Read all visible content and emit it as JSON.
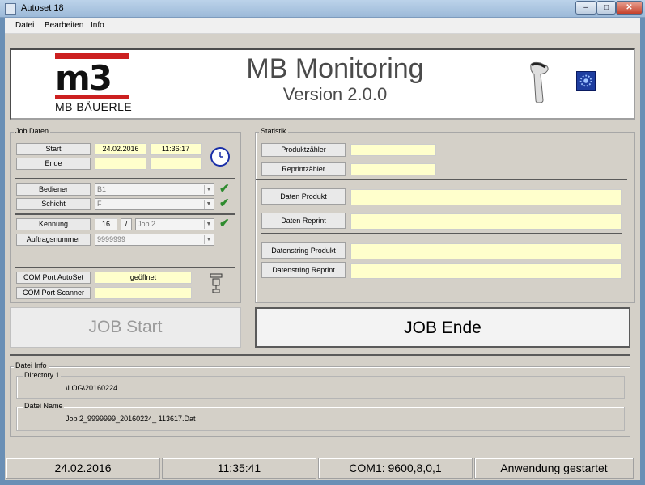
{
  "window": {
    "title": "Autoset 18",
    "minimize": "–",
    "maximize": "□",
    "close": "✕"
  },
  "menu": [
    "Datei",
    "Bearbeiten",
    "Info"
  ],
  "banner": {
    "logo_text": "MB BÄUERLE",
    "logo_mark": "m3",
    "title": "MB Monitoring",
    "version": "Version 2.0.0"
  },
  "job": {
    "group_title": "Job Daten",
    "start_label": "Start",
    "start_date": "24.02.2016",
    "start_time": "11:36:17",
    "end_label": "Ende",
    "end_date": "",
    "end_time": "",
    "operator_label": "Bediener",
    "operator_value": "B1",
    "shift_label": "Schicht",
    "shift_value": "F",
    "id_label": "Kennung",
    "id_num": "16",
    "id_sep": "/",
    "id_job": "Job 2",
    "order_label": "Auftragsnummer",
    "order_value": "9999999",
    "com_autoset_label": "COM Port AutoSet",
    "com_autoset_value": "geöffnet",
    "com_scanner_label": "COM Port Scanner",
    "com_scanner_value": ""
  },
  "stats": {
    "group_title": "Statistik",
    "product_count_label": "Produktzähler",
    "product_count_value": "",
    "reprint_count_label": "Reprintzähler",
    "reprint_count_value": "",
    "data_product_label": "Daten Produkt",
    "data_product_value": "",
    "data_reprint_label": "Daten Reprint",
    "data_reprint_value": "",
    "string_product_label": "Datenstring Produkt",
    "string_product_value": "",
    "string_reprint_label": "Datenstring Reprint",
    "string_reprint_value": ""
  },
  "buttons": {
    "job_start": "JOB Start",
    "job_end": "JOB Ende"
  },
  "file_info": {
    "group_title": "Datei Info",
    "directory_label": "Directory 1",
    "directory_value": "\\LOG\\20160224",
    "filename_label": "Datei Name",
    "filename_value": "Job 2_9999999_20160224_ 113617.Dat"
  },
  "statusbar": {
    "date": "24.02.2016",
    "time": "11:35:41",
    "com": "COM1: 9600,8,0,1",
    "message": "Anwendung gestartet"
  },
  "colors": {
    "value_field": "#ffffcc",
    "checkmark": "#2e8b2e",
    "logo_red": "#cc2020",
    "clock_blue": "#1a2fa8"
  },
  "icons": {
    "check": "✔",
    "dropdown": "▼"
  }
}
